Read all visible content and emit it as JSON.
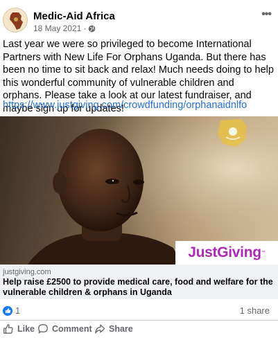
{
  "post": {
    "author": "Medic-Aid Africa",
    "date": "18 May 2021",
    "separator": "·",
    "more_label": "•••",
    "body": "Last year we were so privileged to become International Partners with New Life For Orphans Uganda. But there has been no time to sit back and relax! Much needs doing to help this wonderful community of vulnerable children and orphans. Please take a look at our latest fundraiser, and maybe sign up for updates!",
    "link": "https://www.justgiving.com/crowdfunding/orphanaidnlfo"
  },
  "image": {
    "badge_text": "JustGiving",
    "badge_tm": "™"
  },
  "preview": {
    "domain": "justgiving.com",
    "title": "Help raise £2500 to provide medical care, food and welfare for the vulnerable children & orphans in Uganda"
  },
  "stats": {
    "reactions": "1",
    "shares": "1 share"
  },
  "actions": {
    "like": "Like",
    "comment": "Comment",
    "share": "Share"
  },
  "colors": {
    "link": "#216fdb",
    "justgiving": "#ad29b6",
    "reaction": "#1877f2"
  }
}
